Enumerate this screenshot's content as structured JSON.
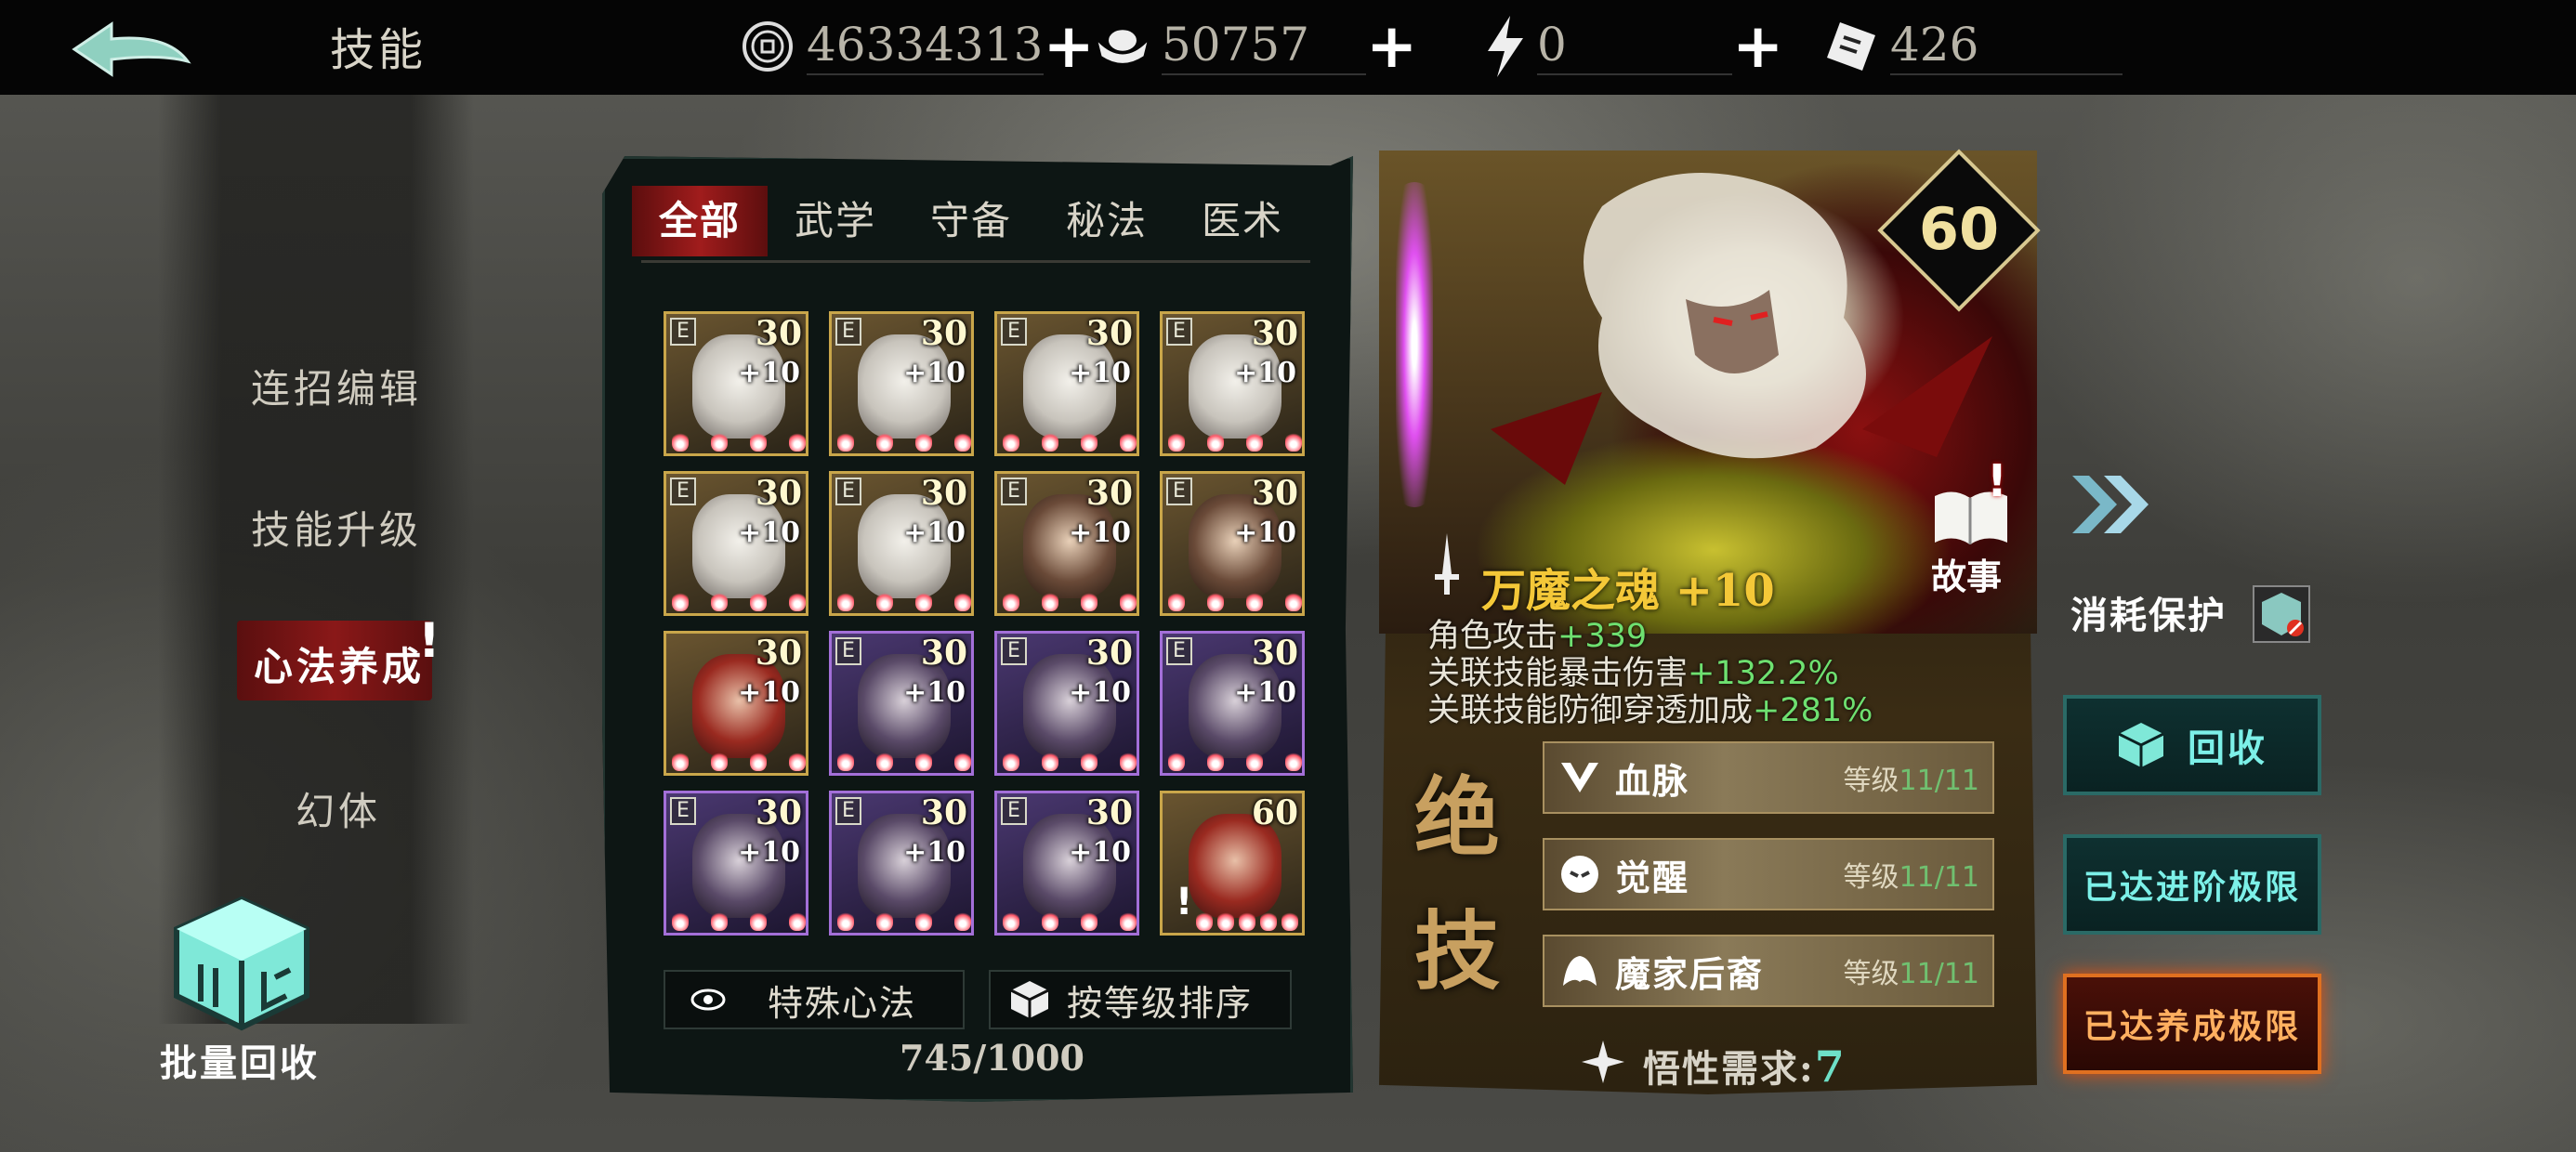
{
  "header": {
    "title": "技能",
    "back_label": "",
    "resources": [
      {
        "icon": "coin-icon",
        "value": "46334313"
      },
      {
        "icon": "silver-ingot-icon",
        "value": "50757"
      },
      {
        "icon": "lightning-icon",
        "value": "0"
      },
      {
        "icon": "ticket-icon",
        "value": "426"
      }
    ],
    "plus": "+"
  },
  "left_menu": {
    "items": [
      "连招编辑",
      "技能升级",
      "心法养成",
      "幻体"
    ],
    "active": "心法养成",
    "alert": "!",
    "batch_recycle": "批量回收"
  },
  "tabs": [
    "全部",
    "武学",
    "守备",
    "秘法",
    "医术"
  ],
  "grid": {
    "cards": [
      {
        "tier": "E",
        "level": "30",
        "plus": "+10",
        "rarity": "gold",
        "face": "white"
      },
      {
        "tier": "E",
        "level": "30",
        "plus": "+10",
        "rarity": "gold",
        "face": "white"
      },
      {
        "tier": "E",
        "level": "30",
        "plus": "+10",
        "rarity": "gold",
        "face": "white"
      },
      {
        "tier": "E",
        "level": "30",
        "plus": "+10",
        "rarity": "gold",
        "face": "white"
      },
      {
        "tier": "E",
        "level": "30",
        "plus": "+10",
        "rarity": "gold",
        "face": "white"
      },
      {
        "tier": "E",
        "level": "30",
        "plus": "+10",
        "rarity": "gold",
        "face": "white"
      },
      {
        "tier": "E",
        "level": "30",
        "plus": "+10",
        "rarity": "gold",
        "face": "brown"
      },
      {
        "tier": "E",
        "level": "30",
        "plus": "+10",
        "rarity": "gold",
        "face": "brown"
      },
      {
        "tier": "",
        "level": "30",
        "plus": "+10",
        "rarity": "gold",
        "face": "red"
      },
      {
        "tier": "E",
        "level": "30",
        "plus": "+10",
        "rarity": "purple",
        "face": "dark"
      },
      {
        "tier": "E",
        "level": "30",
        "plus": "+10",
        "rarity": "purple",
        "face": "dark"
      },
      {
        "tier": "E",
        "level": "30",
        "plus": "+10",
        "rarity": "purple",
        "face": "dark"
      },
      {
        "tier": "E",
        "level": "30",
        "plus": "+10",
        "rarity": "purple",
        "face": "dark"
      },
      {
        "tier": "E",
        "level": "30",
        "plus": "+10",
        "rarity": "purple",
        "face": "dark"
      },
      {
        "tier": "E",
        "level": "30",
        "plus": "+10",
        "rarity": "purple",
        "face": "dark"
      },
      {
        "tier": "",
        "level": "60",
        "plus": "",
        "rarity": "gold",
        "face": "red",
        "selected": true,
        "alert": "!"
      }
    ]
  },
  "special_button": "特殊心法",
  "sort_button": "按等级排序",
  "count": "745/1000",
  "detail": {
    "level": "60",
    "story": "故事",
    "story_alert": "!",
    "name": "万魔之魂 +10",
    "stats": [
      {
        "label": "角色攻击",
        "value": "+339"
      },
      {
        "label": "关联技能暴击伤害",
        "value": "+132.2%"
      },
      {
        "label": "关联技能防御穿透加成",
        "value": "+281%"
      }
    ],
    "jue": [
      "绝",
      "技"
    ],
    "skills": [
      {
        "name": "血脉",
        "lv_label": "等级",
        "lv": "11/11"
      },
      {
        "name": "觉醒",
        "lv_label": "等级",
        "lv": "11/11"
      },
      {
        "name": "魔家后裔",
        "lv_label": "等级",
        "lv": "11/11"
      }
    ],
    "wux_label": "悟性需求:",
    "wux_value": "7"
  },
  "right": {
    "protect": "消耗保护",
    "recycle": "回收",
    "advance_max": "已达进阶极限",
    "train_max": "已达养成极限"
  }
}
